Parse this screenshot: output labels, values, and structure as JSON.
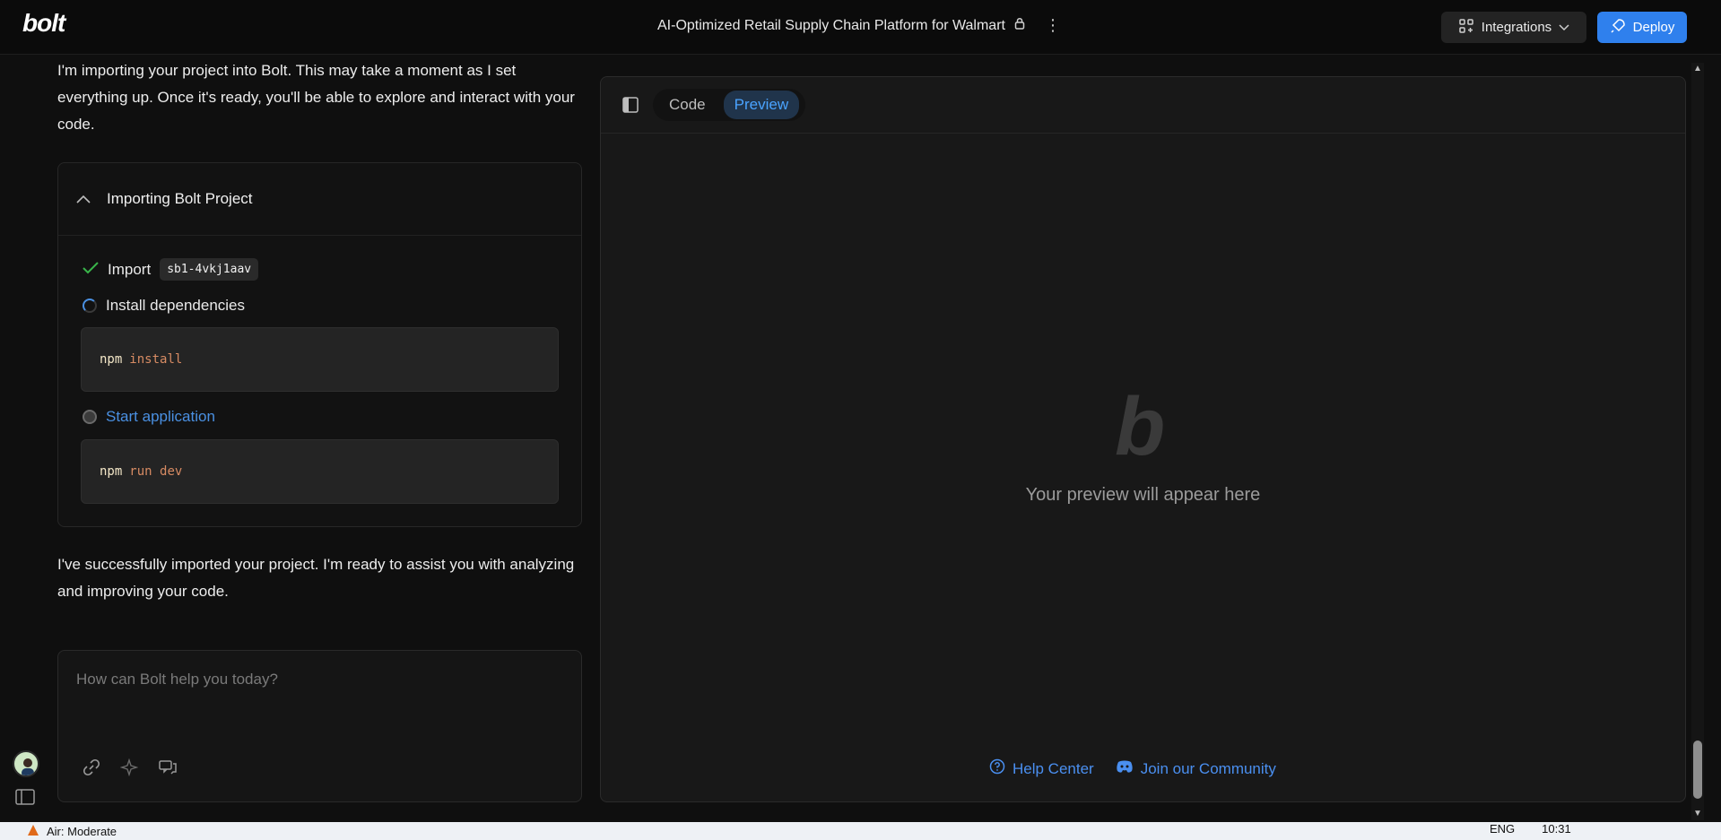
{
  "header": {
    "logo": "bolt",
    "project_title": "AI-Optimized Retail Supply Chain Platform for Walmart",
    "integrations_label": "Integrations",
    "deploy_label": "Deploy"
  },
  "chat": {
    "intro": "I'm importing your project into Bolt. This may take a moment as I set everything up. Once it's ready, you'll be able to explore and interact with your code.",
    "panel_title": "Importing Bolt Project",
    "steps": [
      {
        "label": "Import",
        "code": "sb1-4vkj1aav",
        "status": "done"
      },
      {
        "label": "Install dependencies",
        "status": "in-progress",
        "cmd": "npm",
        "args": "install"
      },
      {
        "label": "Start application",
        "status": "pending",
        "cmd": "npm",
        "args": "run dev"
      }
    ],
    "outro": "I've successfully imported your project. I'm ready to assist you with analyzing and improving your code.",
    "input_placeholder": "How can Bolt help you today?"
  },
  "workbench": {
    "tabs": [
      {
        "label": "Code",
        "active": false
      },
      {
        "label": "Preview",
        "active": true
      }
    ],
    "preview_logo": "b",
    "preview_text": "Your preview will appear here",
    "help_center": "Help Center",
    "community": "Join our Community"
  },
  "taskbar": {
    "weather": "Air: Moderate",
    "language": "ENG",
    "time": "10:31"
  },
  "colors": {
    "accent": "#2f80ed",
    "link": "#4a8ff0",
    "background": "#0f0f0f"
  }
}
